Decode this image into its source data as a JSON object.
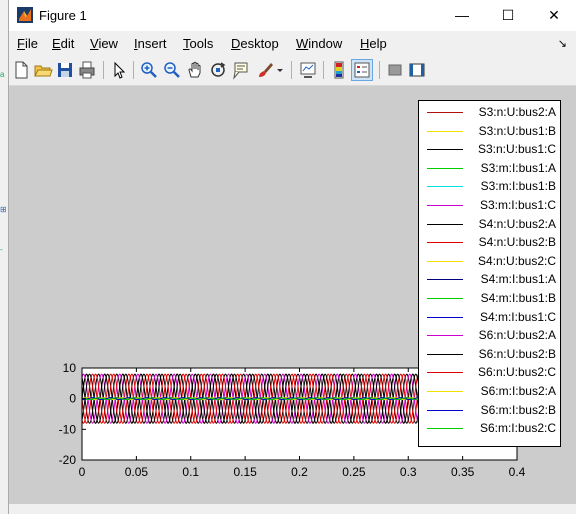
{
  "window": {
    "title": "Figure 1",
    "minimize": "—",
    "maximize": "☐",
    "close": "✕",
    "dock": "↘"
  },
  "menus": [
    "File",
    "Edit",
    "View",
    "Insert",
    "Tools",
    "Desktop",
    "Window",
    "Help"
  ],
  "menu_underline": [
    "F",
    "E",
    "V",
    "I",
    "T",
    "D",
    "W",
    "H"
  ],
  "toolbar_icons": [
    "new-figure-icon",
    "open-file-icon",
    "save-icon",
    "print-icon",
    "edit-plot-arrow-icon",
    "zoom-in-icon",
    "zoom-out-icon",
    "pan-hand-icon",
    "rotate-3d-icon",
    "data-cursor-icon",
    "brush-icon",
    "brush-dropdown-icon",
    "link-plot-icon",
    "insert-colorbar-icon",
    "insert-legend-icon",
    "hide-plot-tools-icon",
    "show-plot-tools-icon"
  ],
  "colors": {
    "figure_bg": "#cccccc",
    "window_bg": "#f0f0f0",
    "axes_bg": "#ffffff"
  },
  "chart_data": {
    "type": "line",
    "x_range": [
      0,
      0.4
    ],
    "ylim": [
      -20,
      10
    ],
    "xticks": [
      "0",
      "0.05",
      "0.1",
      "0.15",
      "0.2",
      "0.25",
      "0.3",
      "0.35",
      "0.4"
    ],
    "yticks": [
      "10",
      "0",
      "-10",
      "-20"
    ],
    "legend_position": "top-right",
    "series": [
      {
        "name": "S3:n:U:bus2:A",
        "color": "#b01010",
        "amplitude": 8,
        "frequency_hz": 60,
        "phase_deg": 0
      },
      {
        "name": "S3:n:U:bus1:B",
        "color": "#f0e000",
        "amplitude": 0.3,
        "frequency_hz": 60,
        "phase_deg": -120
      },
      {
        "name": "S3:n:U:bus1:C",
        "color": "#000000",
        "amplitude": 8,
        "frequency_hz": 60,
        "phase_deg": 120
      },
      {
        "name": "S3:m:I:bus1:A",
        "color": "#00cc00",
        "amplitude": 0.3,
        "frequency_hz": 60,
        "phase_deg": 0
      },
      {
        "name": "S3:m:I:bus1:B",
        "color": "#00e0e0",
        "amplitude": 0.3,
        "frequency_hz": 60,
        "phase_deg": -120
      },
      {
        "name": "S3:m:I:bus1:C",
        "color": "#cc00cc",
        "amplitude": 0.3,
        "frequency_hz": 60,
        "phase_deg": 120
      },
      {
        "name": "S4:n:U:bus2:A",
        "color": "#000000",
        "amplitude": 8,
        "frequency_hz": 60,
        "phase_deg": 0
      },
      {
        "name": "S4:n:U:bus2:B",
        "color": "#dd0000",
        "amplitude": 8,
        "frequency_hz": 60,
        "phase_deg": -120
      },
      {
        "name": "S4:n:U:bus2:C",
        "color": "#f0e000",
        "amplitude": 0.3,
        "frequency_hz": 60,
        "phase_deg": 120
      },
      {
        "name": "S4:m:I:bus1:A",
        "color": "#000080",
        "amplitude": 0.3,
        "frequency_hz": 60,
        "phase_deg": 0
      },
      {
        "name": "S4:m:I:bus1:B",
        "color": "#00cc00",
        "amplitude": 0.3,
        "frequency_hz": 60,
        "phase_deg": -120
      },
      {
        "name": "S4:m:I:bus1:C",
        "color": "#0000cc",
        "amplitude": 0.3,
        "frequency_hz": 60,
        "phase_deg": 120
      },
      {
        "name": "S6:n:U:bus2:A",
        "color": "#cc00cc",
        "amplitude": 8,
        "frequency_hz": 60,
        "phase_deg": 60
      },
      {
        "name": "S6:n:U:bus2:B",
        "color": "#000000",
        "amplitude": 8,
        "frequency_hz": 60,
        "phase_deg": -60
      },
      {
        "name": "S6:n:U:bus2:C",
        "color": "#dd0000",
        "amplitude": 8,
        "frequency_hz": 60,
        "phase_deg": 180
      },
      {
        "name": "S6:m:I:bus2:A",
        "color": "#f0e000",
        "amplitude": 0.3,
        "frequency_hz": 60,
        "phase_deg": 0
      },
      {
        "name": "S6:m:I:bus2:B",
        "color": "#0000cc",
        "amplitude": 0.3,
        "frequency_hz": 60,
        "phase_deg": -120
      },
      {
        "name": "S6:m:I:bus2:C",
        "color": "#00cc00",
        "amplitude": 0.3,
        "frequency_hz": 60,
        "phase_deg": 120
      }
    ]
  }
}
